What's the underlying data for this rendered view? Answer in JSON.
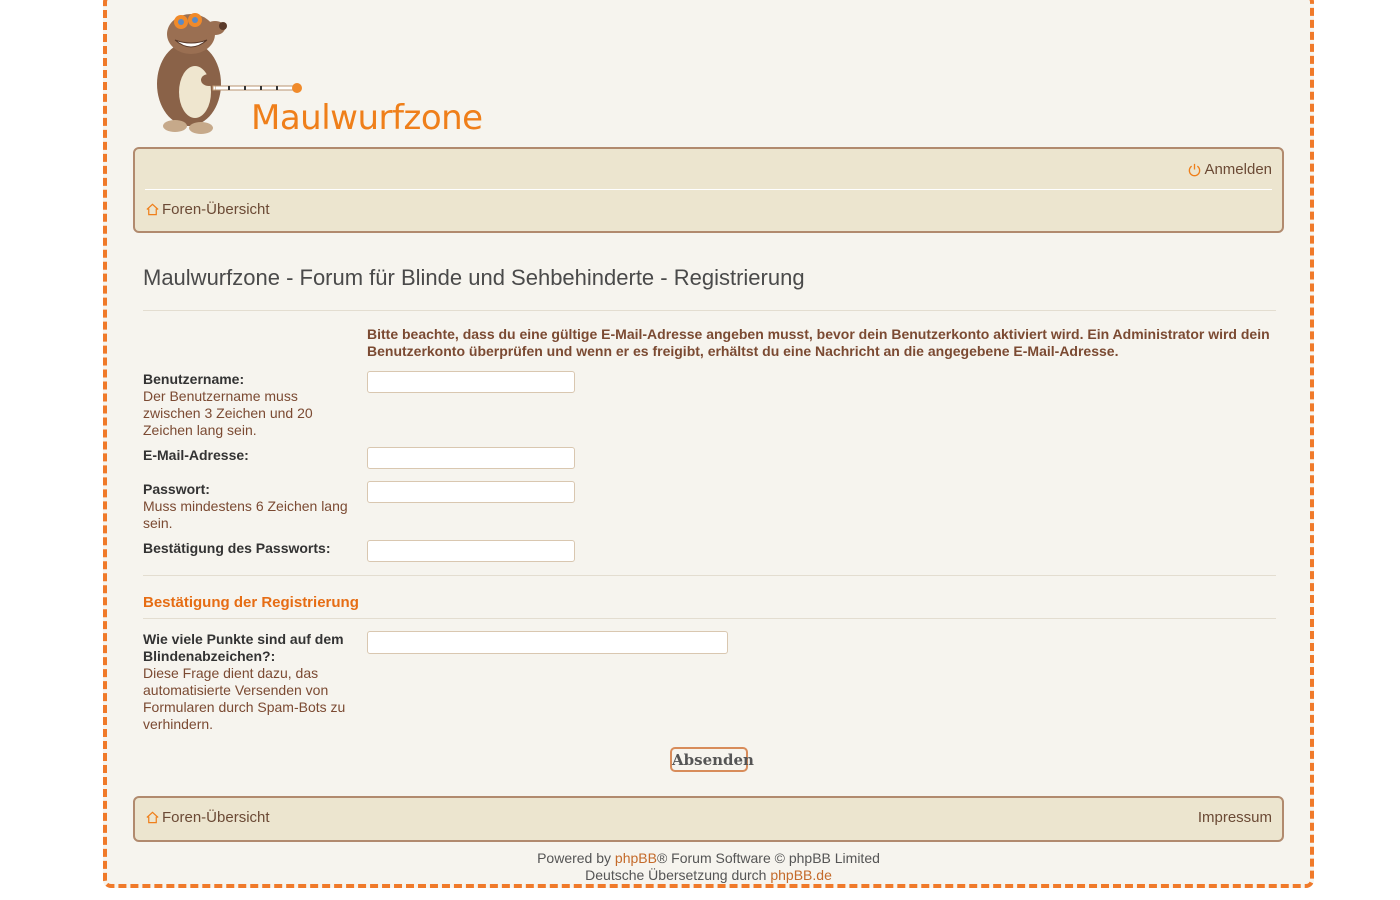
{
  "brand": {
    "name": "Maulwurfzone",
    "colors": {
      "accent": "#ef7f1a",
      "navbar_bg": "#ece5cf",
      "border": "#f07a2a"
    }
  },
  "nav_top": {
    "login_label": "Anmelden",
    "login_icon": "power-icon",
    "home_label": "Foren-Übersicht",
    "home_icon": "home-icon"
  },
  "page": {
    "title": "Maulwurfzone - Forum für Blinde und Sehbehinderte - Registrierung",
    "notice": "Bitte beachte, dass du eine gültige E-Mail-Adresse angeben musst, bevor dein Benutzerkonto aktiviert wird. Ein Administrator wird dein Benutzerkonto überprüfen und wenn er es freigibt, erhältst du eine Nachricht an die angegebene E-Mail-Adresse."
  },
  "form": {
    "username": {
      "label": "Benutzername:",
      "explain": "Der Benutzername muss zwischen 3 Zeichen und 20 Zeichen lang sein.",
      "value": ""
    },
    "email": {
      "label": "E-Mail-Adresse:",
      "value": ""
    },
    "password": {
      "label": "Passwort:",
      "explain": "Muss mindestens 6 Zeichen lang sein.",
      "value": ""
    },
    "password_confirm": {
      "label": "Bestätigung des Passworts:",
      "value": ""
    }
  },
  "captcha": {
    "section_title": "Bestätigung der Registrierung",
    "question": "Wie viele Punkte sind auf dem Blindenabzeichen?:",
    "explain": "Diese Frage dient dazu, das automatisierte Versenden von Formularen durch Spam-Bots zu verhindern.",
    "value": ""
  },
  "submit_label": "Absenden",
  "nav_bottom": {
    "home_label": "Foren-Übersicht",
    "imprint_label": "Impressum"
  },
  "footer": {
    "powered_prefix": "Powered by ",
    "powered_link": "phpBB",
    "powered_suffix": "® Forum Software © phpBB Limited",
    "translation_prefix": "Deutsche Übersetzung durch ",
    "translation_link": "phpBB.de"
  }
}
